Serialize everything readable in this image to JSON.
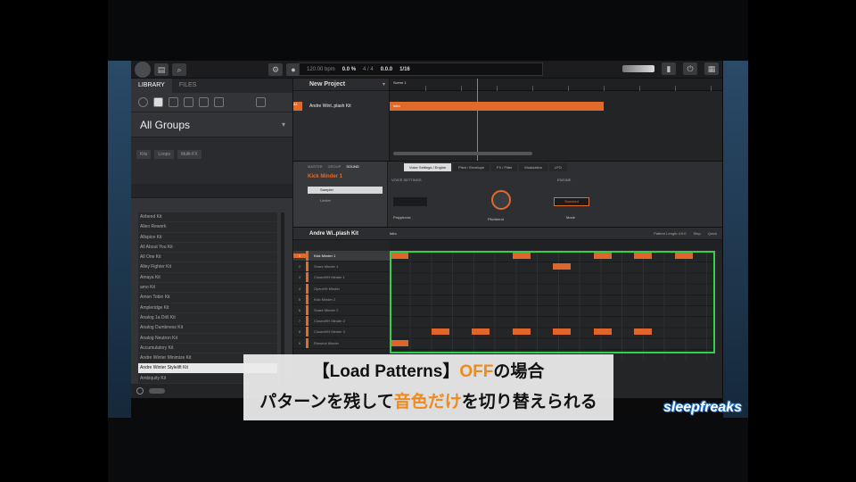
{
  "colors": {
    "accent": "#e06a2a",
    "highlight_box": "#2fd24a",
    "caption_orange": "#f08a1c"
  },
  "toolbar": {
    "tempo": "120.00 bpm",
    "swing": "0.0 %",
    "signature": "4 / 4",
    "position": "0.0.0",
    "grid": "1/16",
    "icons": [
      "logo-icon",
      "folder-icon",
      "search-icon",
      "settings-icon",
      "record-icon"
    ]
  },
  "browser": {
    "tabs": [
      "LIBRARY",
      "FILES"
    ],
    "category": "All Groups",
    "filters": [
      "Kits",
      "Loops",
      "Multi-FX"
    ],
    "kits": [
      "Airbend Kit",
      "Alien Rework",
      "Allspice Kit",
      "All About You Kit",
      "All One Kit",
      "Alley Fighter Kit",
      "Amaya Kit",
      "amo Kit",
      "Amon Tobin Kit",
      "Ampleridge Kit",
      "Analog 1a Drill Kit",
      "Analog Dumbness Kit",
      "Analog Neutron Kit",
      "Accumulatory Kit",
      "Andre Winter Minimize Kit",
      "Andre Winter Stylelift Kit",
      "Ambiquity Kit",
      "Angel Kit",
      "Antifall",
      "Arcane Woodland"
    ],
    "selected_kit_index": 15
  },
  "arranger": {
    "project": "New Project",
    "scene": "Scene 1",
    "group": "Andre Wint..plash Kit",
    "group_label": "A1",
    "clip": "intro"
  },
  "control": {
    "tabs": [
      "MASTER",
      "GROUP",
      "SOUND"
    ],
    "sound": "Kick Minder 1",
    "plugin": "Sampler",
    "plugin2": "Limiter",
    "pages": [
      "Voice Settings / Engine",
      "Pitch / Envelope",
      "FX / Filter",
      "Modulation",
      "LFO"
    ],
    "voice_settings": "VOICE SETTINGS",
    "engine": "ENGINE",
    "polyphony": "Polyphonic",
    "pitchbend": "Pitchbend",
    "mode": "Standard",
    "mode_label": "Mode"
  },
  "pattern": {
    "group_name": "Andre Wi..plash Kit",
    "pattern_name": "intro",
    "pattern_length": "Pattern Length 4:0:0",
    "step": "Step",
    "quick": "Quick",
    "sounds": [
      "Kick Minder 1",
      "Snare Minder 1",
      "ClosedHH Minder 1",
      "OpenHH Minder",
      "Kick Minder 2",
      "Snare Minder 2",
      "ClosedHH Minder 2",
      "ClosedHH Minder 3",
      "Rimshot Minder"
    ],
    "selected_sound_index": 0
  },
  "caption": {
    "line1_a": "【Load Patterns】",
    "line1_b": "OFF",
    "line1_c": "の場合",
    "line2_a": "パターンを残して",
    "line2_b": "音色だけ",
    "line2_c": "を切り替えられる"
  },
  "logo": {
    "text": "sleepfreaks"
  }
}
